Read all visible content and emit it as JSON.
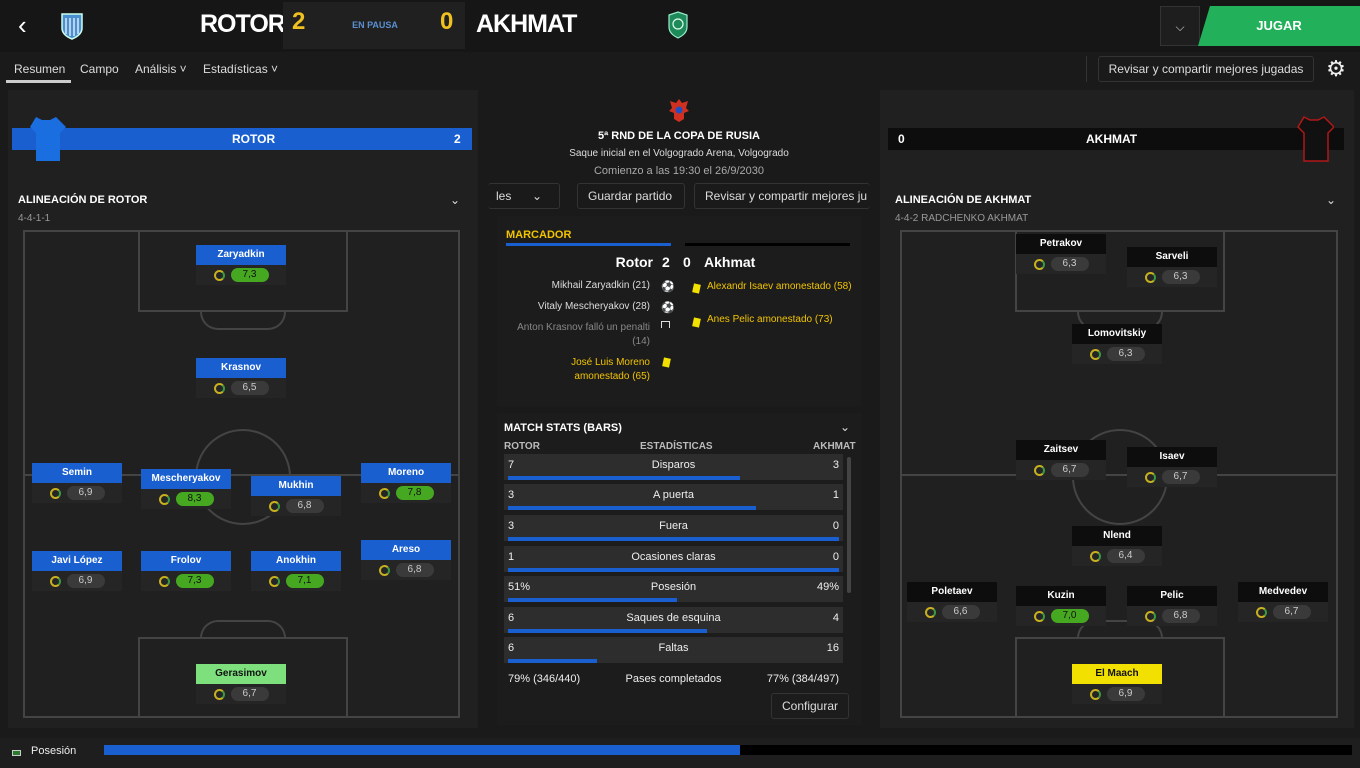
{
  "header": {
    "home": "ROTOR",
    "home_score": "2",
    "status": "EN PAUSA",
    "away_score": "0",
    "away": "AKHMAT",
    "play_label": "JUGAR"
  },
  "tabs": [
    "Resumen",
    "Campo",
    "Análisis ˅",
    "Estadísticas ˅"
  ],
  "share_label": "Revisar y compartir mejores jugadas",
  "home_bar": {
    "name": "ROTOR",
    "score": "2"
  },
  "away_bar": {
    "name": "AKHMAT",
    "score": "0"
  },
  "match": {
    "title": "5ª RND DE LA COPA DE RUSIA",
    "venue": "Saque inicial en el Volgogrado Arena, Volgogrado",
    "time": "Comienzo a las 19:30 el 26/9/2030",
    "btn_partial": "les",
    "btn_save": "Guardar partido",
    "btn_share": "Revisar y compartir mejores ju"
  },
  "home_lineup": {
    "title": "ALINEACIÓN DE ROTOR",
    "formation": "4-4-1-1"
  },
  "away_lineup": {
    "title": "ALINEACIÓN DE AKHMAT",
    "formation": "4-4-2 RADCHENKO AKHMAT"
  },
  "home_players": [
    {
      "name": "Zaryadkin",
      "rating": "7,3",
      "good": true
    },
    {
      "name": "Krasnov",
      "rating": "6,5",
      "good": false
    },
    {
      "name": "Semin",
      "rating": "6,9",
      "good": false
    },
    {
      "name": "Mescheryakov",
      "rating": "8,3",
      "good": true
    },
    {
      "name": "Mukhin",
      "rating": "6,8",
      "good": false
    },
    {
      "name": "Moreno",
      "rating": "7,8",
      "good": true
    },
    {
      "name": "Javi López",
      "rating": "6,9",
      "good": false
    },
    {
      "name": "Frolov",
      "rating": "7,3",
      "good": true
    },
    {
      "name": "Anokhin",
      "rating": "7,1",
      "good": true
    },
    {
      "name": "Areso",
      "rating": "6,8",
      "good": false
    },
    {
      "name": "Gerasimov",
      "rating": "6,7",
      "good": false
    }
  ],
  "away_players": [
    {
      "name": "Petrakov",
      "rating": "6,3",
      "good": false
    },
    {
      "name": "Sarveli",
      "rating": "6,3",
      "good": false
    },
    {
      "name": "Lomovitskiy",
      "rating": "6,3",
      "good": false
    },
    {
      "name": "Zaitsev",
      "rating": "6,7",
      "good": false
    },
    {
      "name": "Isaev",
      "rating": "6,7",
      "good": false
    },
    {
      "name": "Nlend",
      "rating": "6,4",
      "good": false
    },
    {
      "name": "Poletaev",
      "rating": "6,6",
      "good": false
    },
    {
      "name": "Kuzin",
      "rating": "7,0",
      "good": true
    },
    {
      "name": "Pelic",
      "rating": "6,8",
      "good": false
    },
    {
      "name": "Medvedev",
      "rating": "6,7",
      "good": false
    },
    {
      "name": "El Maach",
      "rating": "6,9",
      "good": false
    }
  ],
  "scorecard": {
    "title": "MARCADOR",
    "home": "Rotor",
    "hs": "2",
    "as": "0",
    "away": "Akhmat",
    "home_events": [
      "Mikhail Zaryadkin (21)",
      "Vitaly Mescheryakov (28)",
      "Anton Krasnov falló un penalti (14)",
      "José Luis Moreno amonestado (65)"
    ],
    "away_events": [
      "Alexandr Isaev amonestado (58)",
      "Anes Pelic amonestado (73)"
    ]
  },
  "stats": {
    "title": "MATCH STATS (BARS)",
    "h1": "ROTOR",
    "h2": "ESTADÍSTICAS",
    "h3": "AKHMAT",
    "configure": "Configurar",
    "rows": [
      {
        "l": "7",
        "c": "Disparos",
        "r": "3",
        "f": 0.7
      },
      {
        "l": "3",
        "c": "A puerta",
        "r": "1",
        "f": 0.75
      },
      {
        "l": "3",
        "c": "Fuera",
        "r": "0",
        "f": 1
      },
      {
        "l": "1",
        "c": "Ocasiones claras",
        "r": "0",
        "f": 1
      },
      {
        "l": "51%",
        "c": "Posesión",
        "r": "49%",
        "f": 0.51
      },
      {
        "l": "6",
        "c": "Saques de esquina",
        "r": "4",
        "f": 0.6
      },
      {
        "l": "6",
        "c": "Faltas",
        "r": "16",
        "f": 0.27
      },
      {
        "l": "79% (346/440)",
        "c": "Pases completados",
        "r": "77% (384/497)",
        "f": null
      }
    ]
  },
  "footer": {
    "label": "Posesión",
    "home_possession": 0.51
  },
  "colors": {
    "home": "#1a5fd0",
    "play": "#23b05a",
    "score": "#f0c020",
    "good": "#45a820"
  }
}
